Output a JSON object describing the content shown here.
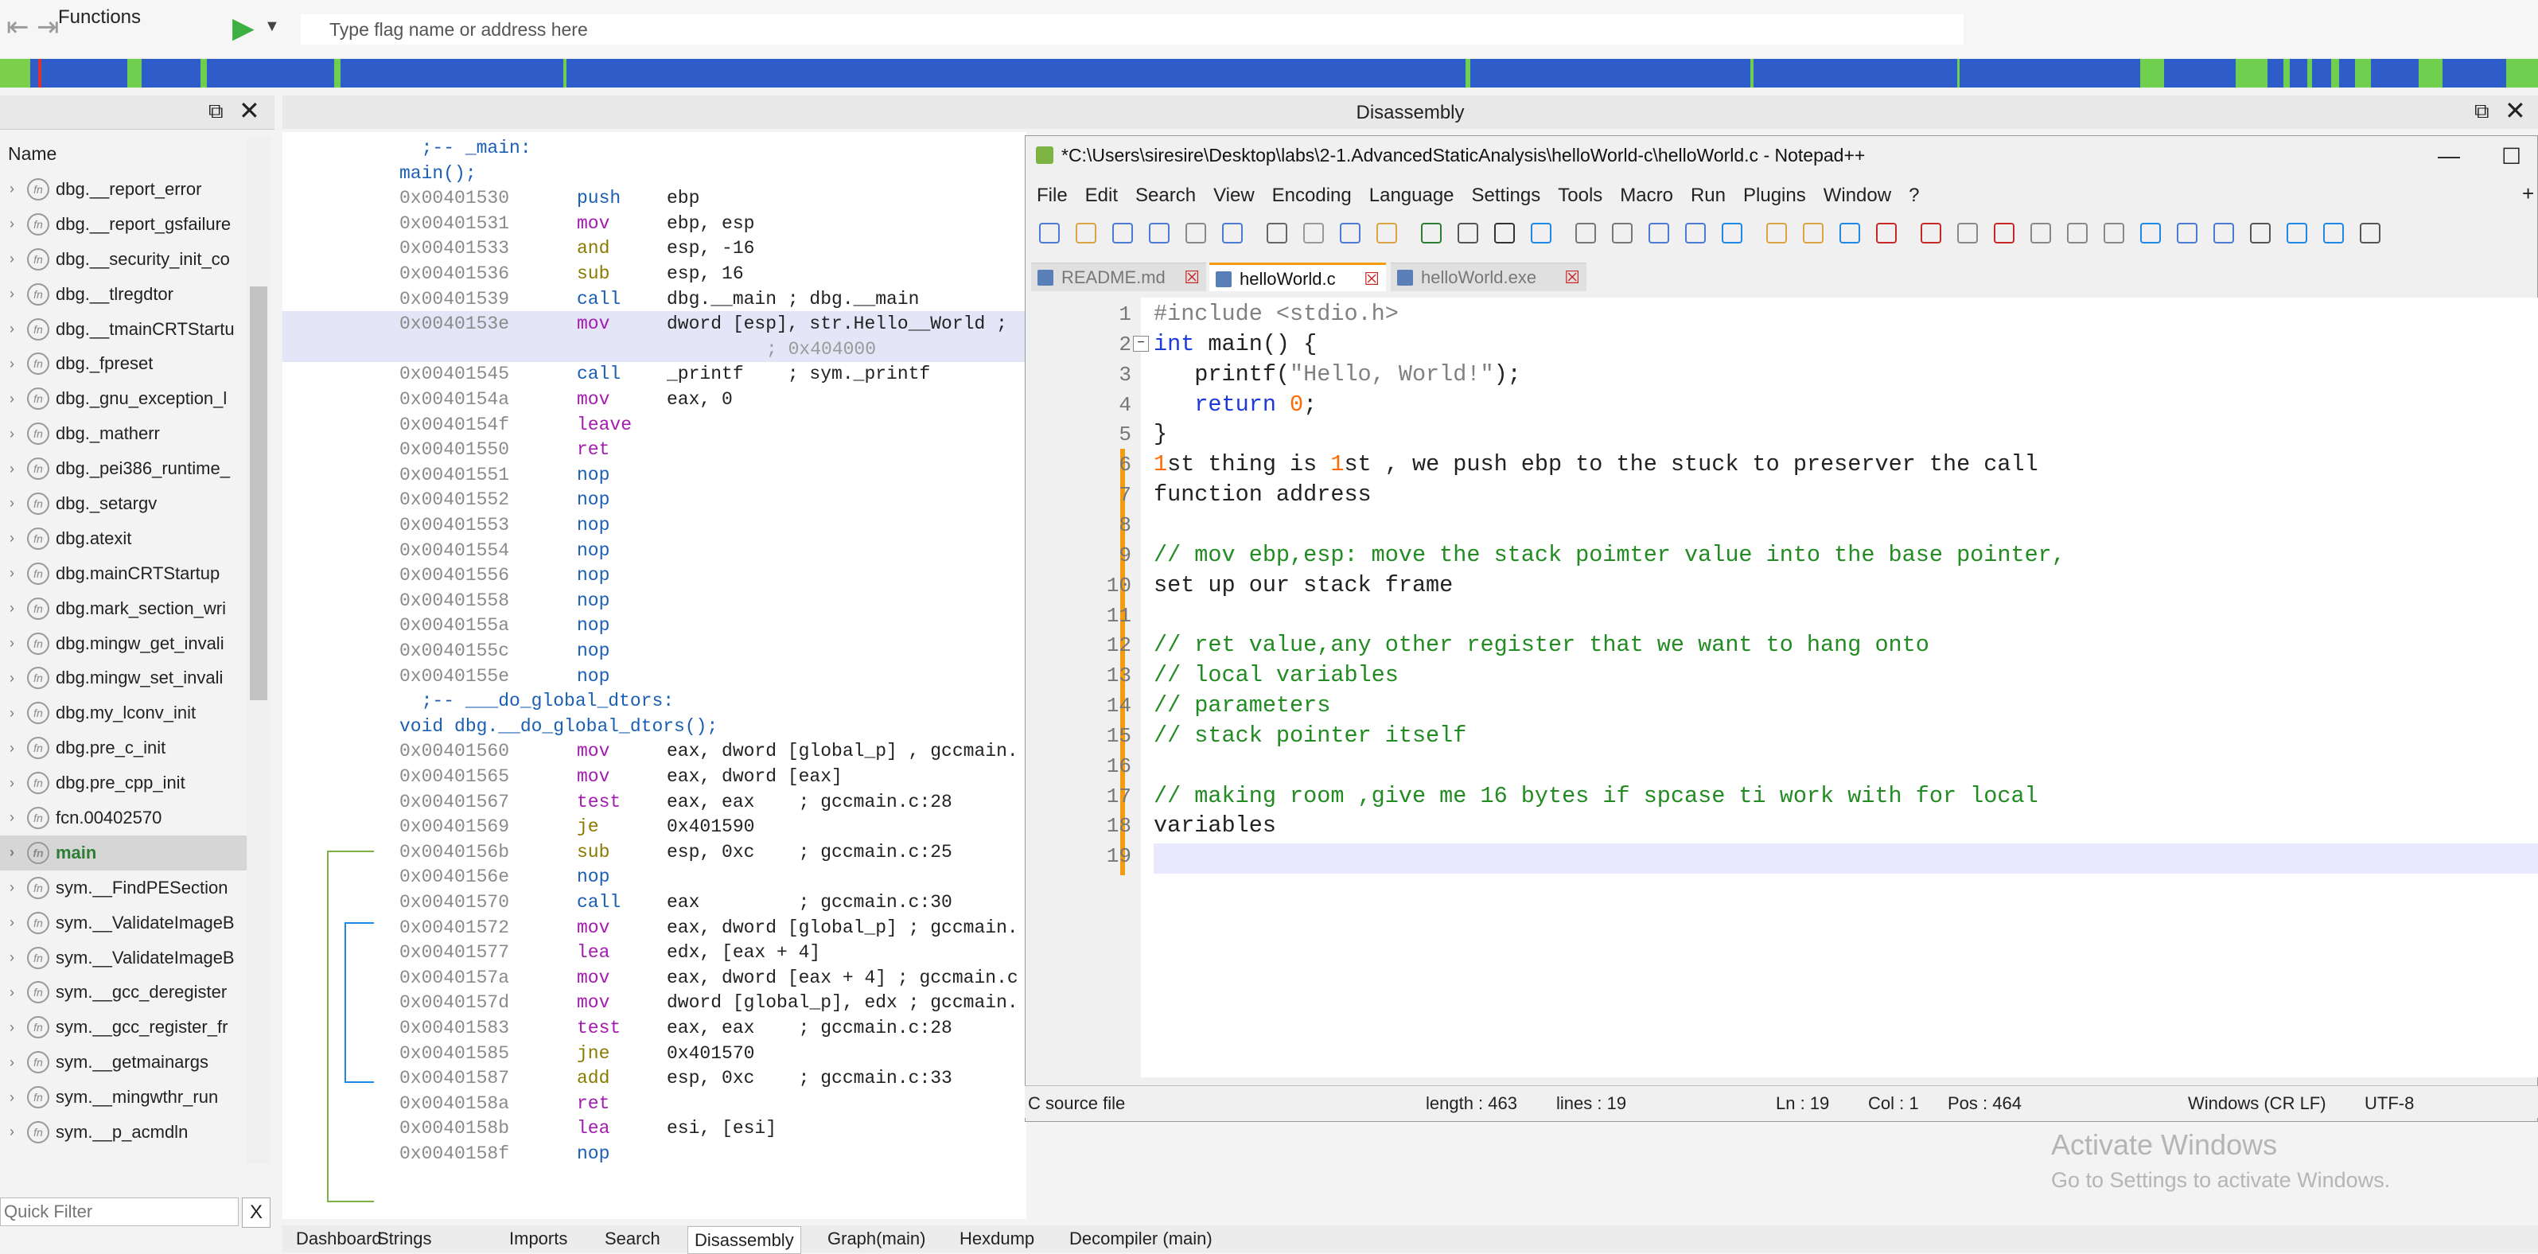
{
  "toolbar": {
    "flag_placeholder": "Type flag name or address here"
  },
  "functions_panel": {
    "title": "Functions",
    "column_name": "Name",
    "quick_filter_placeholder": "Quick Filter",
    "clear_label": "X",
    "items": [
      {
        "label": "dbg.__report_error",
        "active": false
      },
      {
        "label": "dbg.__report_gsfailure",
        "active": false
      },
      {
        "label": "dbg.__security_init_co",
        "active": false
      },
      {
        "label": "dbg.__tlregdtor",
        "active": false
      },
      {
        "label": "dbg.__tmainCRTStartu",
        "active": false
      },
      {
        "label": "dbg._fpreset",
        "active": false
      },
      {
        "label": "dbg._gnu_exception_l",
        "active": false
      },
      {
        "label": "dbg._matherr",
        "active": false
      },
      {
        "label": "dbg._pei386_runtime_",
        "active": false
      },
      {
        "label": "dbg._setargv",
        "active": false
      },
      {
        "label": "dbg.atexit",
        "active": false
      },
      {
        "label": "dbg.mainCRTStartup",
        "active": false
      },
      {
        "label": "dbg.mark_section_wri",
        "active": false
      },
      {
        "label": "dbg.mingw_get_invali",
        "active": false
      },
      {
        "label": "dbg.mingw_set_invali",
        "active": false
      },
      {
        "label": "dbg.my_lconv_init",
        "active": false
      },
      {
        "label": "dbg.pre_c_init",
        "active": false
      },
      {
        "label": "dbg.pre_cpp_init",
        "active": false
      },
      {
        "label": "fcn.00402570",
        "active": false
      },
      {
        "label": "main",
        "active": true
      },
      {
        "label": "sym.__FindPESection",
        "active": false
      },
      {
        "label": "sym.__ValidateImageB",
        "active": false
      },
      {
        "label": "sym.__ValidateImageB",
        "active": false
      },
      {
        "label": "sym.__gcc_deregister",
        "active": false
      },
      {
        "label": "sym.__gcc_register_fr",
        "active": false
      },
      {
        "label": "sym.__getmainargs",
        "active": false
      },
      {
        "label": "sym.__mingwthr_run",
        "active": false
      },
      {
        "label": "sym.__p_acmdln",
        "active": false
      }
    ]
  },
  "disassembly": {
    "title": "Disassembly",
    "lines": [
      {
        "kind": "label",
        "text": "  ;-- _main:"
      },
      {
        "kind": "label",
        "text": "main();"
      },
      {
        "kind": "ins",
        "addr": "0x00401530",
        "mn": "push",
        "mc": "m-blue",
        "ops": "ebp"
      },
      {
        "kind": "ins",
        "addr": "0x00401531",
        "mn": "mov",
        "mc": "m-purple",
        "ops": "ebp, esp"
      },
      {
        "kind": "ins",
        "addr": "0x00401533",
        "mn": "and",
        "mc": "m-olive",
        "ops": "esp, -16"
      },
      {
        "kind": "ins",
        "addr": "0x00401536",
        "mn": "sub",
        "mc": "m-olive",
        "ops": "esp, 16"
      },
      {
        "kind": "ins",
        "addr": "0x00401539",
        "mn": "call",
        "mc": "m-blue",
        "ops": "dbg.__main ; dbg.__main"
      },
      {
        "kind": "ins",
        "addr": "0x0040153e",
        "mn": "mov",
        "mc": "m-purple",
        "ops": "dword [esp], str.Hello__World ;",
        "hl": true
      },
      {
        "kind": "cont",
        "text": "; 0x404000",
        "hl": true
      },
      {
        "kind": "ins",
        "addr": "0x00401545",
        "mn": "call",
        "mc": "m-blue",
        "ops": "_printf    ; sym._printf"
      },
      {
        "kind": "ins",
        "addr": "0x0040154a",
        "mn": "mov",
        "mc": "m-purple",
        "ops": "eax, 0"
      },
      {
        "kind": "ins",
        "addr": "0x0040154f",
        "mn": "leave",
        "mc": "m-purple",
        "ops": ""
      },
      {
        "kind": "ins",
        "addr": "0x00401550",
        "mn": "ret",
        "mc": "m-purple",
        "ops": ""
      },
      {
        "kind": "ins",
        "addr": "0x00401551",
        "mn": "nop",
        "mc": "m-blue",
        "ops": ""
      },
      {
        "kind": "ins",
        "addr": "0x00401552",
        "mn": "nop",
        "mc": "m-blue",
        "ops": ""
      },
      {
        "kind": "ins",
        "addr": "0x00401553",
        "mn": "nop",
        "mc": "m-blue",
        "ops": ""
      },
      {
        "kind": "ins",
        "addr": "0x00401554",
        "mn": "nop",
        "mc": "m-blue",
        "ops": ""
      },
      {
        "kind": "ins",
        "addr": "0x00401556",
        "mn": "nop",
        "mc": "m-blue",
        "ops": ""
      },
      {
        "kind": "ins",
        "addr": "0x00401558",
        "mn": "nop",
        "mc": "m-blue",
        "ops": ""
      },
      {
        "kind": "ins",
        "addr": "0x0040155a",
        "mn": "nop",
        "mc": "m-blue",
        "ops": ""
      },
      {
        "kind": "ins",
        "addr": "0x0040155c",
        "mn": "nop",
        "mc": "m-blue",
        "ops": ""
      },
      {
        "kind": "ins",
        "addr": "0x0040155e",
        "mn": "nop",
        "mc": "m-blue",
        "ops": ""
      },
      {
        "kind": "label",
        "text": "  ;-- ___do_global_dtors:"
      },
      {
        "kind": "label",
        "text": "void dbg.__do_global_dtors();"
      },
      {
        "kind": "ins",
        "addr": "0x00401560",
        "mn": "mov",
        "mc": "m-purple",
        "ops": "eax, dword [global_p] , gccmain."
      },
      {
        "kind": "ins",
        "addr": "0x00401565",
        "mn": "mov",
        "mc": "m-purple",
        "ops": "eax, dword [eax]"
      },
      {
        "kind": "ins",
        "addr": "0x00401567",
        "mn": "test",
        "mc": "m-purple",
        "ops": "eax, eax    ; gccmain.c:28"
      },
      {
        "kind": "ins",
        "addr": "0x00401569",
        "mn": "je",
        "mc": "m-olive",
        "ops": "0x401590"
      },
      {
        "kind": "ins",
        "addr": "0x0040156b",
        "mn": "sub",
        "mc": "m-olive",
        "ops": "esp, 0xc    ; gccmain.c:25"
      },
      {
        "kind": "ins",
        "addr": "0x0040156e",
        "mn": "nop",
        "mc": "m-blue",
        "ops": ""
      },
      {
        "kind": "ins",
        "addr": "0x00401570",
        "mn": "call",
        "mc": "m-blue",
        "ops": "eax         ; gccmain.c:30"
      },
      {
        "kind": "ins",
        "addr": "0x00401572",
        "mn": "mov",
        "mc": "m-purple",
        "ops": "eax, dword [global_p] ; gccmain."
      },
      {
        "kind": "ins",
        "addr": "0x00401577",
        "mn": "lea",
        "mc": "m-purple",
        "ops": "edx, [eax + 4]"
      },
      {
        "kind": "ins",
        "addr": "0x0040157a",
        "mn": "mov",
        "mc": "m-purple",
        "ops": "eax, dword [eax + 4] ; gccmain.c"
      },
      {
        "kind": "ins",
        "addr": "0x0040157d",
        "mn": "mov",
        "mc": "m-purple",
        "ops": "dword [global_p], edx ; gccmain."
      },
      {
        "kind": "ins",
        "addr": "0x00401583",
        "mn": "test",
        "mc": "m-purple",
        "ops": "eax, eax    ; gccmain.c:28"
      },
      {
        "kind": "ins",
        "addr": "0x00401585",
        "mn": "jne",
        "mc": "m-olive",
        "ops": "0x401570"
      },
      {
        "kind": "ins",
        "addr": "0x00401587",
        "mn": "add",
        "mc": "m-olive",
        "ops": "esp, 0xc    ; gccmain.c:33"
      },
      {
        "kind": "ins",
        "addr": "0x0040158a",
        "mn": "ret",
        "mc": "m-purple",
        "ops": ""
      },
      {
        "kind": "ins",
        "addr": "0x0040158b",
        "mn": "lea",
        "mc": "m-purple",
        "ops": "esi, [esi]"
      },
      {
        "kind": "ins",
        "addr": "0x0040158f",
        "mn": "nop",
        "mc": "m-blue",
        "ops": ""
      }
    ]
  },
  "bottom_tabs": [
    {
      "label": "Dashboard",
      "active": false
    },
    {
      "label": "Strings",
      "active": false
    },
    {
      "label": "Imports",
      "active": false
    },
    {
      "label": "Search",
      "active": false
    },
    {
      "label": "Disassembly",
      "active": true
    },
    {
      "label": "Graph(main)",
      "active": false
    },
    {
      "label": "Hexdump",
      "active": false
    },
    {
      "label": "Decompiler (main)",
      "active": false
    }
  ],
  "notepad": {
    "title": "*C:\\Users\\siresire\\Desktop\\labs\\2-1.AdvancedStaticAnalysis\\helloWorld-c\\helloWorld.c - Notepad++",
    "menu": [
      "File",
      "Edit",
      "Search",
      "View",
      "Encoding",
      "Language",
      "Settings",
      "Tools",
      "Macro",
      "Run",
      "Plugins",
      "Window",
      "?"
    ],
    "plus": "+",
    "tabs": [
      {
        "label": "README.md",
        "active": false
      },
      {
        "label": "helloWorld.c",
        "active": true
      },
      {
        "label": "helloWorld.exe",
        "active": false
      }
    ],
    "lines": [
      {
        "n": "1",
        "segs": [
          [
            "k-gray",
            "#include <stdio.h>"
          ]
        ]
      },
      {
        "n": "2",
        "segs": [
          [
            "k-blue",
            "int"
          ],
          [
            "",
            " main() {"
          ]
        ]
      },
      {
        "n": "3",
        "segs": [
          [
            "",
            "   printf("
          ],
          [
            "k-gray",
            "\"Hello, World!\""
          ],
          [
            "",
            ");"
          ]
        ]
      },
      {
        "n": "4",
        "segs": [
          [
            "",
            "   "
          ],
          [
            "k-blue",
            "return"
          ],
          [
            "",
            " "
          ],
          [
            "k-num",
            "0"
          ],
          [
            "",
            ";"
          ]
        ]
      },
      {
        "n": "5",
        "segs": [
          [
            "",
            "}"
          ]
        ]
      },
      {
        "n": "6",
        "segs": [
          [
            "k-num",
            "1"
          ],
          [
            "",
            "st thing is "
          ],
          [
            "k-num",
            "1"
          ],
          [
            "",
            "st , we push ebp to the stuck to preserver the call"
          ]
        ]
      },
      {
        "n": "7",
        "segs": [
          [
            "",
            "function address"
          ]
        ]
      },
      {
        "n": "8",
        "segs": [
          [
            "",
            ""
          ]
        ]
      },
      {
        "n": "9",
        "segs": [
          [
            "k-cmt",
            "// mov ebp,esp: move the stack poimter value into the base pointer,"
          ]
        ]
      },
      {
        "n": "10",
        "segs": [
          [
            "",
            "set up our stack frame"
          ]
        ]
      },
      {
        "n": "11",
        "segs": [
          [
            "",
            ""
          ]
        ]
      },
      {
        "n": "12",
        "segs": [
          [
            "k-cmt",
            "// ret value,any other register that we want to hang onto"
          ]
        ]
      },
      {
        "n": "13",
        "segs": [
          [
            "k-cmt",
            "// local variables"
          ]
        ]
      },
      {
        "n": "14",
        "segs": [
          [
            "k-cmt",
            "// parameters"
          ]
        ]
      },
      {
        "n": "15",
        "segs": [
          [
            "k-cmt",
            "// stack pointer itself"
          ]
        ]
      },
      {
        "n": "16",
        "segs": [
          [
            "",
            ""
          ]
        ]
      },
      {
        "n": "17",
        "segs": [
          [
            "k-cmt",
            "// making room ,give me 16 bytes if spcase ti work with for local"
          ]
        ]
      },
      {
        "n": "18",
        "segs": [
          [
            "",
            "variables"
          ]
        ]
      },
      {
        "n": "19",
        "segs": [
          [
            "",
            ""
          ]
        ]
      }
    ],
    "status": {
      "type": "C source file",
      "length": "length : 463",
      "lines": "lines : 19",
      "ln": "Ln : 19",
      "col": "Col : 1",
      "pos": "Pos : 464",
      "eol": "Windows (CR LF)",
      "encoding": "UTF-8"
    }
  },
  "watermark": {
    "line1": "Activate Windows",
    "line2": "Go to Settings to activate Windows."
  }
}
